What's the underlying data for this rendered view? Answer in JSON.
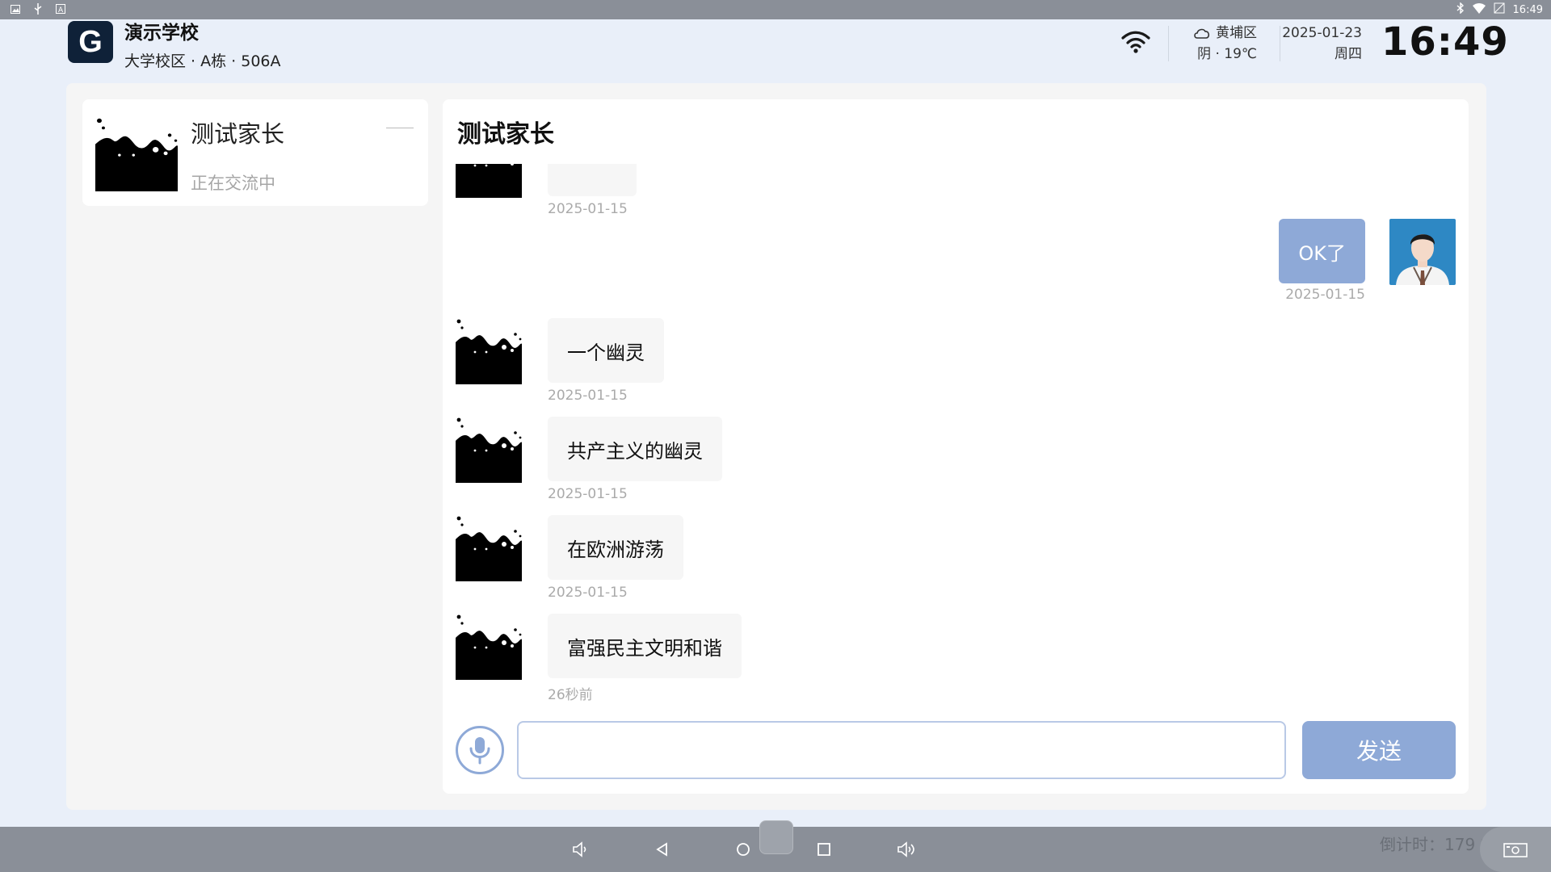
{
  "statusbar": {
    "time": "16:49",
    "left_icons": [
      "image-icon",
      "usb-icon",
      "notification-icon"
    ],
    "right_icons": [
      "bluetooth-icon",
      "wifi-icon",
      "battery-icon"
    ]
  },
  "header": {
    "logo_letter": "G",
    "school_name": "演示学校",
    "location": "大学校区 · A栋 · 506A",
    "weather": {
      "district": "黄埔区",
      "condition": "阴 · 19℃"
    },
    "date": "2025-01-23",
    "weekday": "周四",
    "clock": "16:49"
  },
  "contact": {
    "name": "测试家长",
    "status": "正在交流中"
  },
  "chat": {
    "title": "测试家长",
    "messages": [
      {
        "side": "left",
        "text": "",
        "time": "2025-01-15"
      },
      {
        "side": "right",
        "text": "OK了",
        "time": "2025-01-15"
      },
      {
        "side": "left",
        "text": "一个幽灵",
        "time": "2025-01-15"
      },
      {
        "side": "left",
        "text": "共产主义的幽灵",
        "time": "2025-01-15"
      },
      {
        "side": "left",
        "text": "在欧洲游荡",
        "time": "2025-01-15"
      },
      {
        "side": "left",
        "text": "富强民主文明和谐",
        "time": "26秒前"
      }
    ],
    "input": {
      "value": "",
      "placeholder": ""
    },
    "send_label": "发送"
  },
  "navbar": {
    "countdown": "倒计时：179 S"
  },
  "colors": {
    "accent": "#8ea9d7",
    "bars": "#8a8f98",
    "background": "#e9eff9"
  }
}
